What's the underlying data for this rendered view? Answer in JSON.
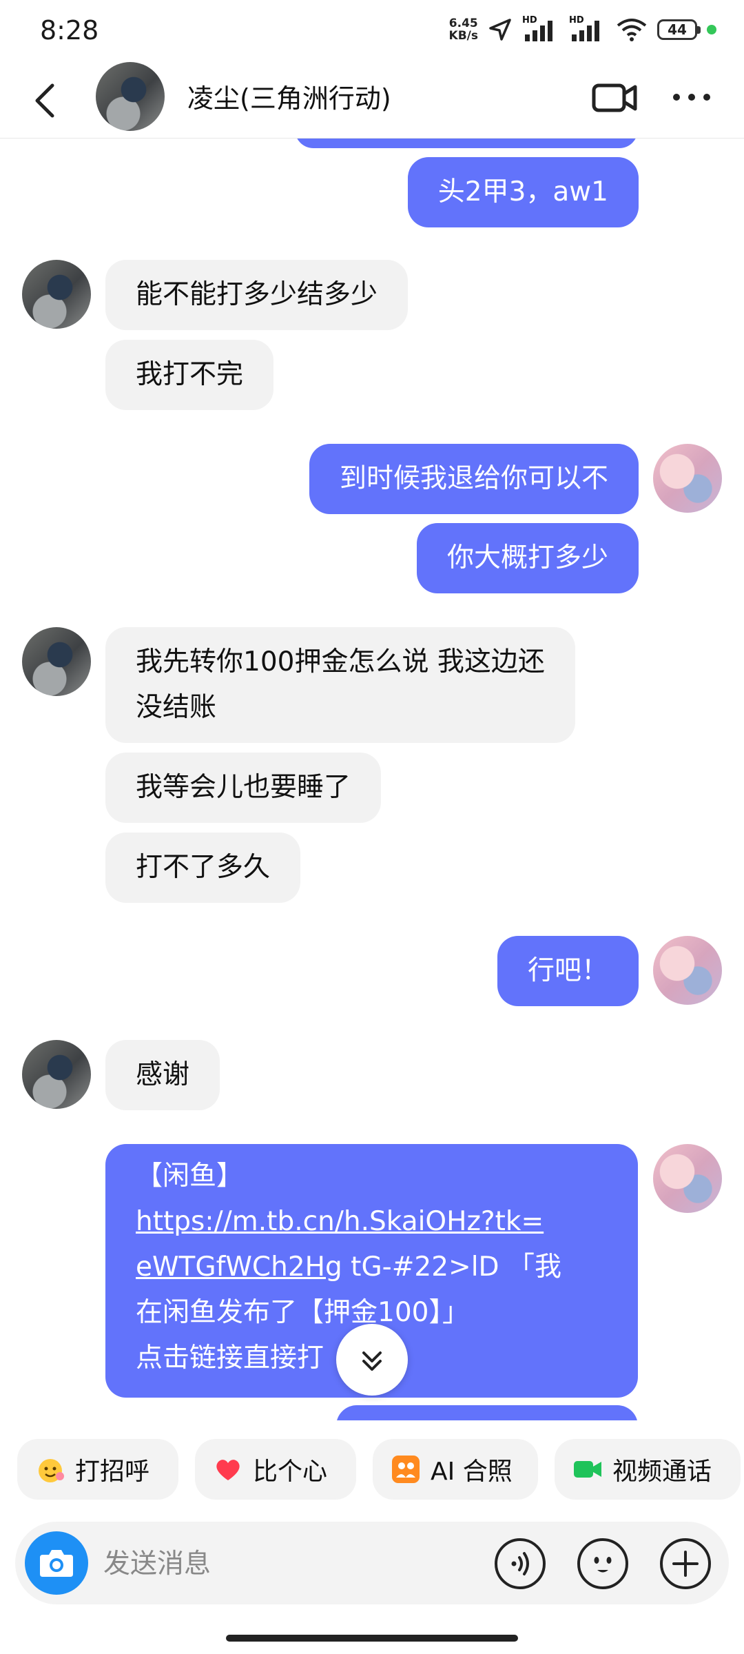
{
  "status": {
    "time": "8:28",
    "speed_value": "6.45",
    "speed_unit": "KB/s",
    "hd1": "HD",
    "hd2": "HD",
    "battery": "44"
  },
  "header": {
    "title": "凌尘(三角洲行动)"
  },
  "messages": [
    {
      "from": "me",
      "text": "头2甲3，aw1"
    },
    {
      "from": "them",
      "text": "能不能打多少结多少"
    },
    {
      "from": "them",
      "text": "我打不完"
    },
    {
      "from": "me",
      "text": "到时候我退给你可以不"
    },
    {
      "from": "me",
      "text": "你大概打多少"
    },
    {
      "from": "them",
      "text": "我先转你100押金怎么说 我这边还"
    },
    {
      "from": "them",
      "text": "没结账"
    },
    {
      "from": "them",
      "text": "我等会儿也要睡了"
    },
    {
      "from": "them",
      "text": "打不了多久"
    },
    {
      "from": "me",
      "text": "行吧！"
    },
    {
      "from": "them",
      "text": "感谢"
    }
  ],
  "link_message": {
    "prefix": "【闲鱼】",
    "url_line1": "https://m.tb.cn/h.SkaiOHz?tk=",
    "url_line2": "eWTGfWCh2Hg",
    "after_url": " tG-#22>lD 「我",
    "line3": "在闲鱼发布了【押金100】」",
    "line4": "点击链接直接打"
  },
  "chips": [
    {
      "label": "打招呼",
      "icon": "wave-emoji-icon"
    },
    {
      "label": "比个心",
      "icon": "heart-icon"
    },
    {
      "label": "AI 合照",
      "icon": "ai-photo-icon"
    },
    {
      "label": "视频通话",
      "icon": "video-call-icon"
    }
  ],
  "input": {
    "placeholder": "发送消息"
  },
  "colors": {
    "my_bubble": "#6273fb",
    "their_bubble": "#f2f2f2",
    "camera_button": "#1e90f5"
  }
}
